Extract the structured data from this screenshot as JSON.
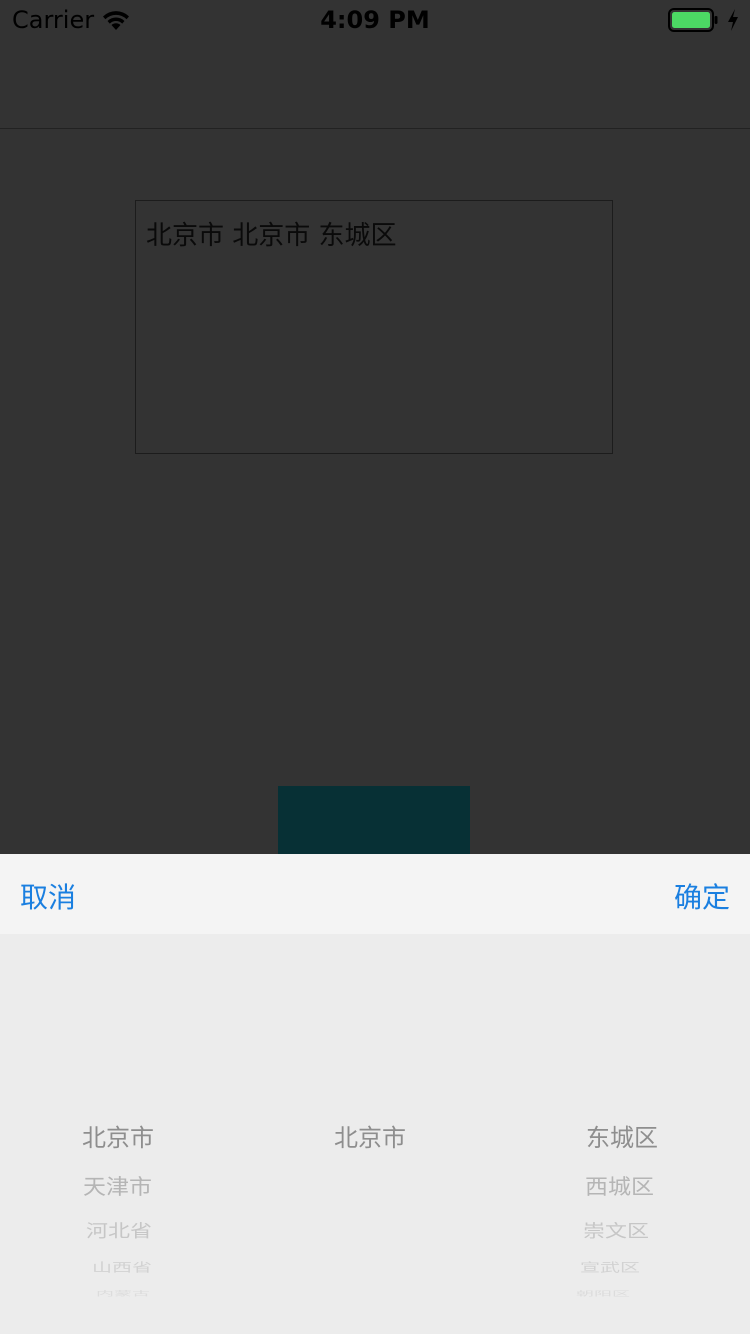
{
  "status_bar": {
    "carrier": "Carrier",
    "time": "4:09 PM",
    "battery_color": "#4cd964"
  },
  "address_display": {
    "text": "北京市 北京市 东城区"
  },
  "picker": {
    "cancel_label": "取消",
    "confirm_label": "确定",
    "accent_color": "#1a7fe0",
    "provinces": [
      "北京市",
      "天津市",
      "河北省",
      "山西省",
      "内蒙古"
    ],
    "cities": [
      "北京市"
    ],
    "districts": [
      "东城区",
      "西城区",
      "崇文区",
      "宣武区",
      "朝阳区"
    ]
  }
}
